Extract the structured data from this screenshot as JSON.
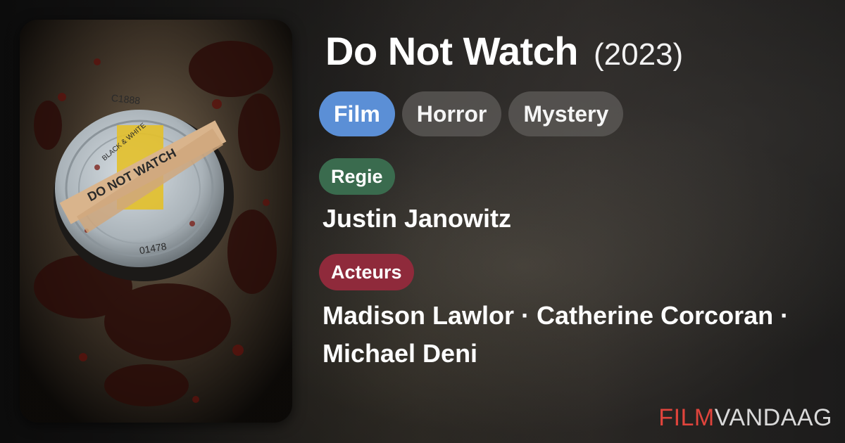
{
  "movie": {
    "title": "Do Not Watch",
    "year": "(2023)"
  },
  "genres": [
    {
      "label": "Film"
    },
    {
      "label": "Horror"
    },
    {
      "label": "Mystery"
    }
  ],
  "director": {
    "label": "Regie",
    "name": "Justin Janowitz"
  },
  "cast": {
    "label": "Acteurs",
    "line1": "Madison Lawlor · Catherine Corcoran ·",
    "line2": "Michael Deni"
  },
  "poster": {
    "reel_label": "C1888",
    "reel_number": "01478",
    "tape_text": "DO NOT WATCH",
    "sticker_text": "BLACK & WHITE"
  },
  "brand": {
    "part1": "FILM",
    "part2": "VANDAAG"
  },
  "colors": {
    "genre_primary": "#5b8fd6",
    "genre_chip": "#5f5c5a",
    "director_pill": "#3a6b4e",
    "cast_pill": "#8f2a3b",
    "brand_red": "#e0443c",
    "brand_gray": "#d9d9d9"
  }
}
